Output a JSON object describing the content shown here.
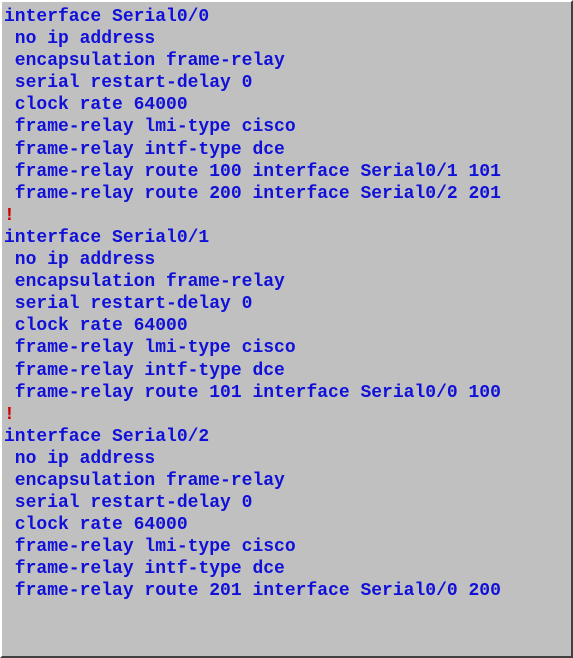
{
  "interfaces": [
    {
      "name": "Serial0/0",
      "lines": [
        "no ip address",
        "encapsulation frame-relay",
        "serial restart-delay 0",
        "clock rate 64000",
        "frame-relay lmi-type cisco",
        "frame-relay intf-type dce",
        "frame-relay route 100 interface Serial0/1 101",
        "frame-relay route 200 interface Serial0/2 201"
      ]
    },
    {
      "name": "Serial0/1",
      "lines": [
        "no ip address",
        "encapsulation frame-relay",
        "serial restart-delay 0",
        "clock rate 64000",
        "frame-relay lmi-type cisco",
        "frame-relay intf-type dce",
        "frame-relay route 101 interface Serial0/0 100"
      ]
    },
    {
      "name": "Serial0/2",
      "lines": [
        "no ip address",
        "encapsulation frame-relay",
        "serial restart-delay 0",
        "clock rate 64000",
        "frame-relay lmi-type cisco",
        "frame-relay intf-type dce",
        "frame-relay route 201 interface Serial0/0 200"
      ]
    }
  ],
  "separator": "!",
  "interface_keyword": "interface"
}
